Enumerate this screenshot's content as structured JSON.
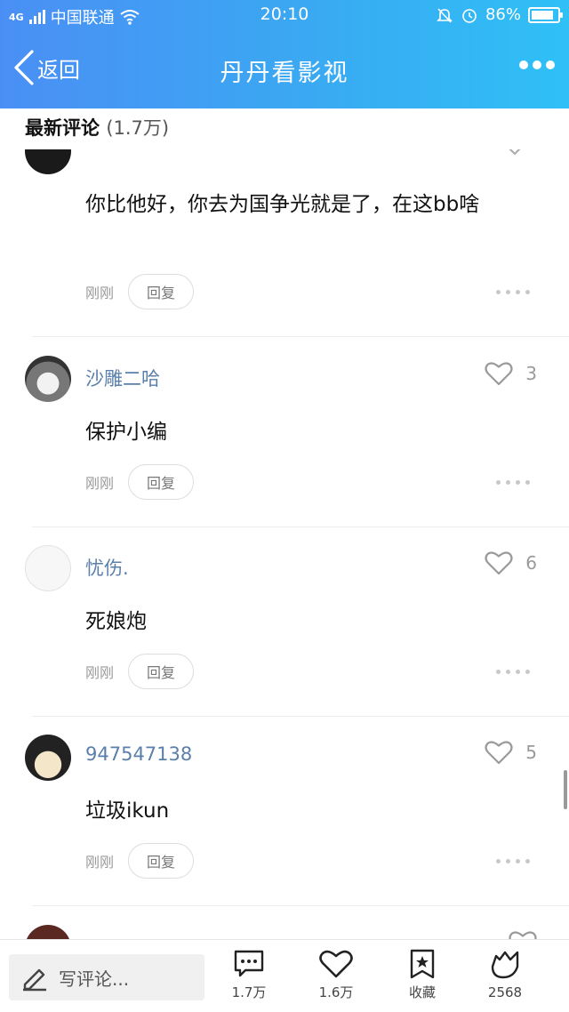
{
  "status_bar": {
    "network": "4G",
    "carrier": "中国联通",
    "time": "20:10",
    "battery": "86%",
    "battery_level": 0.86
  },
  "nav": {
    "back_label": "返回",
    "title": "丹丹看影视"
  },
  "section": {
    "title": "最新评论",
    "count": "(1.7万)"
  },
  "comments": [
    {
      "username": "",
      "likes": "",
      "text": "你比他好，你去为国争光就是了，在这bb啥",
      "time": "刚刚",
      "reply_label": "回复"
    },
    {
      "username": "沙雕二哈",
      "likes": "3",
      "text": "保护小编",
      "time": "刚刚",
      "reply_label": "回复"
    },
    {
      "username": "忧伤.",
      "likes": "6",
      "text": "死娘炮",
      "time": "刚刚",
      "reply_label": "回复"
    },
    {
      "username": "947547138",
      "likes": "5",
      "text": "垃圾ikun",
      "time": "刚刚",
      "reply_label": "回复"
    }
  ],
  "bottom_bar": {
    "compose_placeholder": "写评论...",
    "comments_count": "1.7万",
    "likes_count": "1.6万",
    "favorite_label": "收藏",
    "share_count": "2568"
  },
  "colors": {
    "header_gradient_start": "#4a8ff5",
    "header_gradient_end": "#2fc0f6",
    "username": "#5a7fab",
    "icon_gray": "#9a9a9a"
  }
}
